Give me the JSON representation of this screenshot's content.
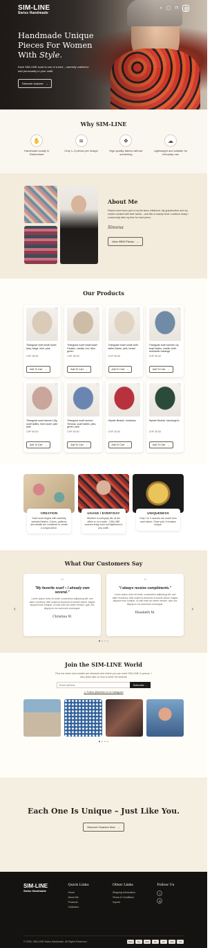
{
  "brand": {
    "name": "SIM-LINE",
    "tagline": "Swiss Handmade"
  },
  "nav": {
    "icons": [
      "search-icon",
      "user-icon",
      "bag-icon",
      "menu-icon"
    ]
  },
  "hero": {
    "title_line1": "Handmade Unique",
    "title_line2": "Pieces For Women",
    "title_line3_prefix": "With ",
    "title_line3_em": "Style.",
    "subtitle": "Each SIM-LINE scarf is one of a kind – carefully crafted to add personality to your outfit.",
    "cta": "Discover scarves"
  },
  "why": {
    "title": "Why SIM-LINE",
    "items": [
      {
        "icon": "swiss-hand-icon",
        "text": "Handmade locally in Switzerland"
      },
      {
        "icon": "layers-icon",
        "text": "Only 1–3 pieces per design"
      },
      {
        "icon": "fabric-icon",
        "text": "High-quality fabrics without scratching"
      },
      {
        "icon": "feather-icon",
        "text": "Lightweight and suitable for everyday use"
      }
    ]
  },
  "about": {
    "title": "About Me",
    "body": "Fabrics have been part of my life since childhood. My grandmother and my mother created with their hands – and this is exactly what I continue today. I consciously take my time for each piece...",
    "signature": "Simona",
    "cta": "View NEW Pieces"
  },
  "products": {
    "title": "Our Products",
    "add_label": "Add To Cart",
    "items": [
      {
        "name": "Triangular cloth small towel fairy, beige, mint, pink",
        "price": "CHF 35.00",
        "color": "#d9cbb8"
      },
      {
        "name": "Triangular scarf small towel Pauline, vanilla, red, olive green",
        "price": "CHF 35.00",
        "color": "#cdbca6"
      },
      {
        "name": "Triangular towel small cloth ladies Marie, pink, brown",
        "price": "CHF 35.00",
        "color": "#e2d4c3"
      },
      {
        "name": "Triangular scarf women ivy, scarf ladies, muslin cloth, anthracite melange",
        "price": "CHF 50.00",
        "color": "#6f8ba6"
      },
      {
        "name": "Triangular scarf women Lilly, scarf ladies, linen scarf, pale pink",
        "price": "CHF 50.00",
        "color": "#c9a59c"
      },
      {
        "name": "Triangular scarf women Simona, scarf ladies, pink, green, pink",
        "price": "CHF 50.00",
        "color": "#6a86b0"
      },
      {
        "name": "Hipster Beanie, bordeaux",
        "price": "CHF 30.00",
        "color": "#b8323d"
      },
      {
        "name": "Hipster Beanie, tannengrün",
        "price": "CHF 30.00",
        "color": "#2c4a3a"
      }
    ]
  },
  "features": [
    {
      "title": "CREATION",
      "text": "Each scarf begins with carefully selected fabrics. Colors, patterns and details are combined to create a unique piece."
    },
    {
      "title": "USAGE / EVERYDAY",
      "text": "Whether in everyday life, at the office or on a walk – SIM-LINE scarves bring color and lightness to any outfit."
    },
    {
      "title": "UNIQUENESS",
      "text": "Only 1 to 3 scarves are made from each fabric. Once sold, it remains unique."
    }
  ],
  "testimonials": {
    "title": "What Our Customers Say",
    "items": [
      {
        "quote": "\"My favorite scarf – I already own several.\"",
        "body": "Lorem ipsum dolor sit amet, consectetur adipiscing elit, sed diam nonummy nibh euismod tincidunt ut laoreet dolore magna aliquam erat volutpat. Ut wisi enim ad minim veniam, quis nos aliquip ex ea commodo consequat.",
        "name": "Christina W."
      },
      {
        "quote": "\"I always receive compliments.\"",
        "body": "Lorem ipsum dolor sit amet, consectetur adipiscing elit, sed diam nonummy nibh euismod tincidunt ut laoreet dolore magna aliquam erat volutpat. Ut wisi enim ad minim veniam, quis nos aliquip ex ea commodo consequat.",
        "name": "Elisabeth M."
      }
    ]
  },
  "world": {
    "title": "Join the SIM-LINE World",
    "desc": "Find out when new models are released and where you can meet SIM-LINE in person. I also share tips on how to wear the scarves",
    "email_placeholder": "Email address",
    "subscribe": "Subscribe",
    "follow": "Follow @simline.ch on Instagram"
  },
  "cta": {
    "title": "Each One Is Unique – Just Like You.",
    "button": "Discover Scarves Now"
  },
  "footer": {
    "quick_links_title": "Quick Links",
    "quick_links": [
      "Home",
      "About Me",
      "Products",
      "Collection"
    ],
    "other_links_title": "Other Links",
    "other_links": [
      "Shipping Information",
      "Terms & Conditions",
      "Imprint"
    ],
    "follow_title": "Follow Us",
    "copyright": "© 2026, SIM-LINE Swiss Handmade. All Rights Reserved.",
    "payments": [
      "AMEX",
      "Pay",
      "GPay",
      "MC",
      "PP",
      "VISA",
      "TW"
    ]
  }
}
